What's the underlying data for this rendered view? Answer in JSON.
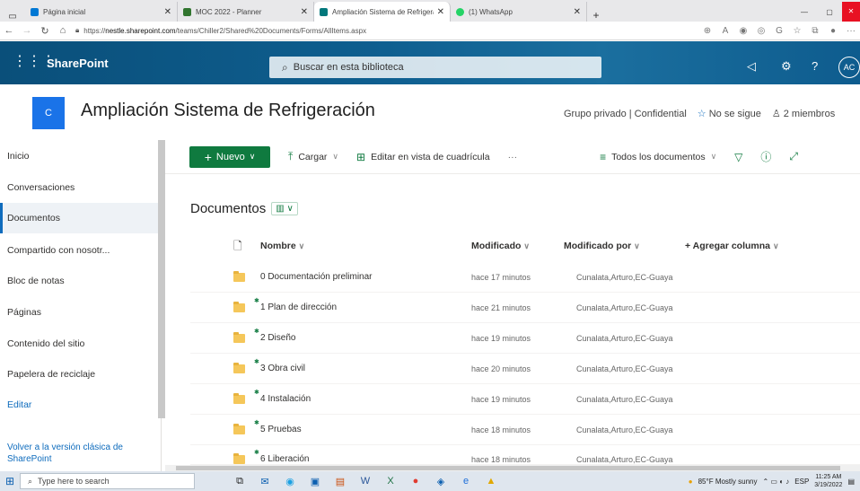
{
  "browser": {
    "tabs": [
      {
        "label": "Página inicial",
        "icon": "sharepoint-icon",
        "color": "#0078d4",
        "active": false
      },
      {
        "label": "MOC 2022 - Planner",
        "icon": "planner-icon",
        "color": "#31752f",
        "active": false
      },
      {
        "label": "Ampliación Sistema de Refrigera",
        "icon": "sharepoint-icon",
        "color": "#03787c",
        "active": true
      },
      {
        "label": "(1) WhatsApp",
        "icon": "whatsapp-icon",
        "color": "#25d366",
        "active": false
      }
    ],
    "url_prefix": "https://",
    "url_host": "nestle.sharepoint.com",
    "url_path": "/teams/Chiller2/Shared%20Documents/Forms/AllItems.aspx"
  },
  "suitebar": {
    "brand": "SharePoint",
    "search_placeholder": "Buscar en esta biblioteca",
    "avatar": "AC"
  },
  "site": {
    "logo_letter": "C",
    "title": "Ampliación Sistema de Refrigeración",
    "privacy": "Grupo privado | Confidential",
    "follow": "No se sigue",
    "members": "2 miembros"
  },
  "nav": {
    "items": [
      {
        "label": "Inicio"
      },
      {
        "label": "Conversaciones"
      },
      {
        "label": "Documentos"
      },
      {
        "label": "Compartido con nosotr..."
      },
      {
        "label": "Bloc de notas"
      },
      {
        "label": "Páginas"
      },
      {
        "label": "Contenido del sitio"
      },
      {
        "label": "Papelera de reciclaje"
      },
      {
        "label": "Editar"
      }
    ],
    "classic_link": "Volver a la versión clásica de SharePoint"
  },
  "commands": {
    "new": "Nuevo",
    "upload": "Cargar",
    "grid_edit": "Editar en vista de cuadrícula",
    "more": "···",
    "view": "Todos los documentos"
  },
  "library": {
    "title": "Documentos",
    "columns": {
      "name": "Nombre",
      "modified": "Modificado",
      "modified_by": "Modificado por",
      "add_column": "+ Agregar columna"
    },
    "rows": [
      {
        "name": "0 Documentación preliminar",
        "modified": "hace 17 minutos",
        "by": "Cunalata,Arturo,EC-Guaya"
      },
      {
        "name": "1 Plan de dirección",
        "modified": "hace 21 minutos",
        "by": "Cunalata,Arturo,EC-Guaya"
      },
      {
        "name": "2 Diseño",
        "modified": "hace 19 minutos",
        "by": "Cunalata,Arturo,EC-Guaya"
      },
      {
        "name": "3 Obra civil",
        "modified": "hace 20 minutos",
        "by": "Cunalata,Arturo,EC-Guaya"
      },
      {
        "name": "4 Instalación",
        "modified": "hace 19 minutos",
        "by": "Cunalata,Arturo,EC-Guaya"
      },
      {
        "name": "5 Pruebas",
        "modified": "hace 18 minutos",
        "by": "Cunalata,Arturo,EC-Guaya"
      },
      {
        "name": "6 Liberación",
        "modified": "hace 18 minutos",
        "by": "Cunalata,Arturo,EC-Guaya"
      }
    ]
  },
  "taskbar": {
    "search": "Type here to search",
    "weather": "85°F  Mostly sunny",
    "lang": "ESP",
    "time": "11:25 AM",
    "date": "3/19/2022"
  },
  "colors": {
    "accent": "#0f7a3f",
    "link": "#0f6cbd",
    "suite": "#0a4f7a"
  }
}
